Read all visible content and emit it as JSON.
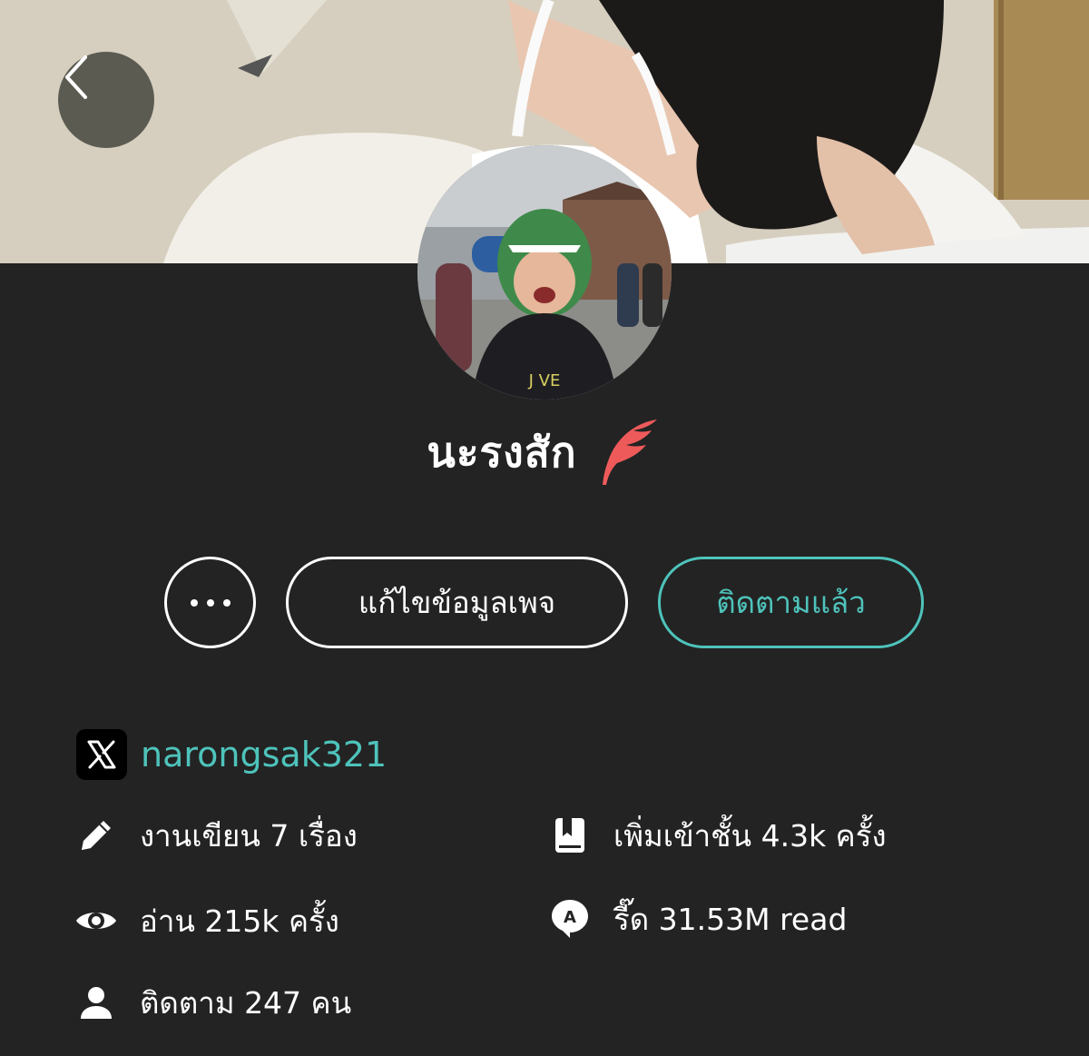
{
  "profile": {
    "name": "นะรงสัก",
    "twitter_handle": "narongsak321"
  },
  "buttons": {
    "more_label": "•••",
    "edit_label": "แก้ไขข้อมูลเพจ",
    "follow_label": "ติดตามแล้ว"
  },
  "stats": {
    "works": "งานเขียน 7 เรื่อง",
    "reads": "อ่าน 215k ครั้ง",
    "followers": "ติดตาม 247 คน",
    "shelf": "เพิ่มเข้าชั้น 4.3k ครั้ง",
    "readathon": "รี๊ด 31.53M read"
  },
  "icons": {
    "back": "chevron-left-icon",
    "writer_badge": "quill-feather-icon",
    "twitter": "x-logo-icon",
    "works": "pencil-icon",
    "reads": "eye-icon",
    "followers": "person-icon",
    "shelf": "bookmark-book-icon",
    "readathon": "speech-bubble-a-icon"
  },
  "colors": {
    "background": "#232323",
    "accent": "#4ec3bb",
    "feather": "#ee5a5a",
    "text": "#ffffff"
  }
}
